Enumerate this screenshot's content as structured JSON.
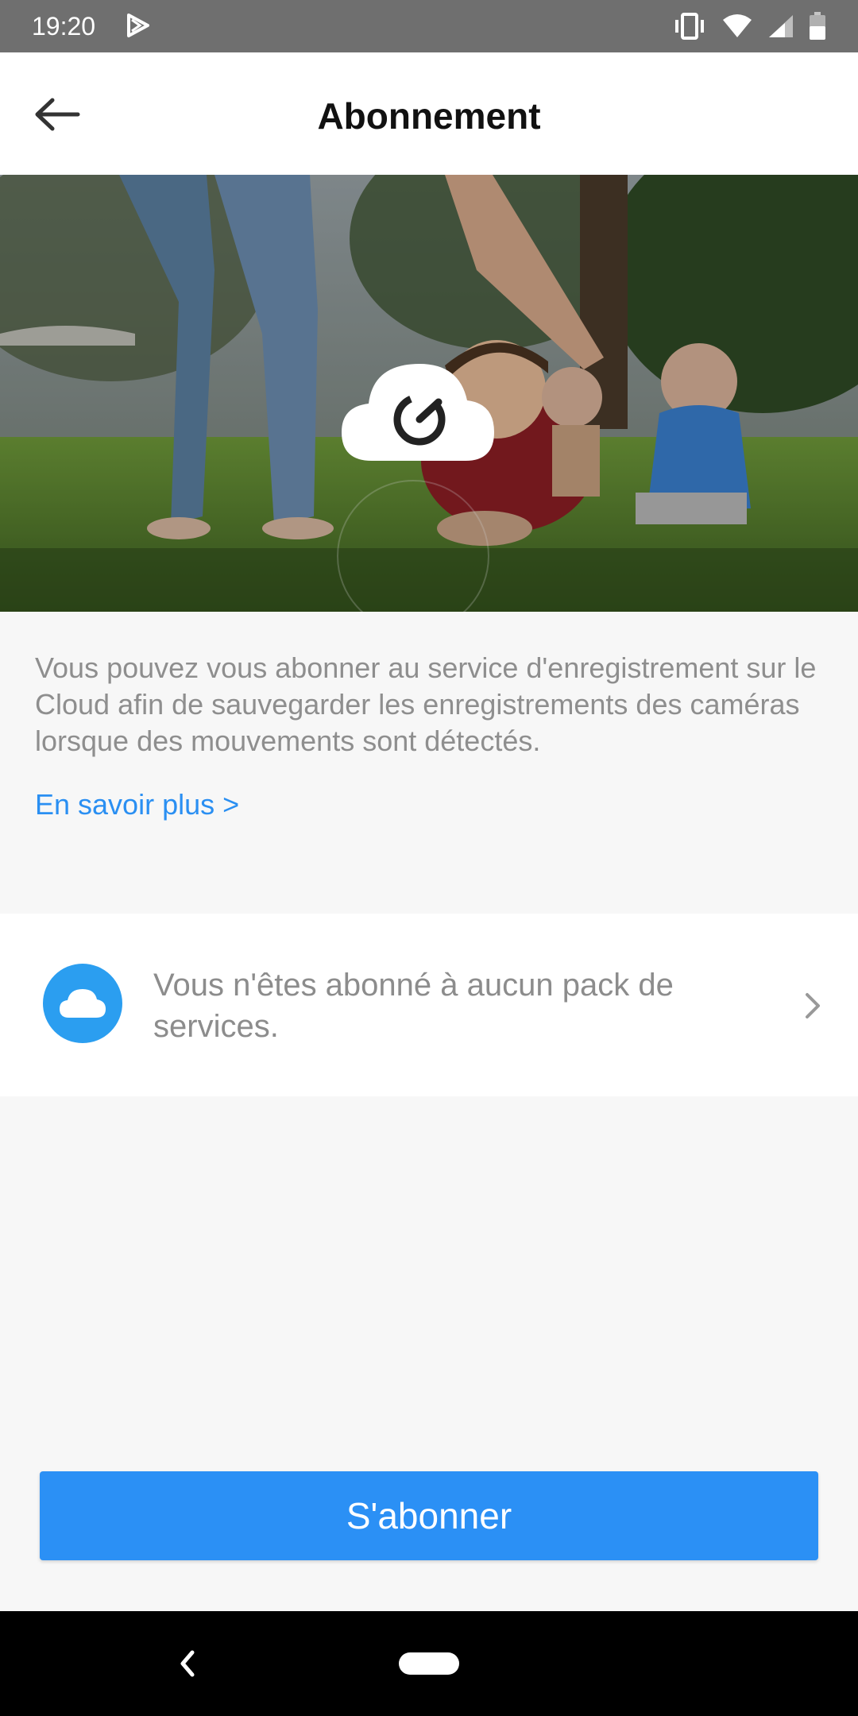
{
  "status_bar": {
    "time": "19:20"
  },
  "app_bar": {
    "title": "Abonnement"
  },
  "hero": {
    "logo_icon": "cloud-logo-icon"
  },
  "description": "Vous pouvez vous abonner au service d'enregistrement sur le Cloud afin de sauvegarder les enregistrements des caméras lorsque des mouvements sont détectés.",
  "learn_more_label": "En savoir plus >",
  "subscription": {
    "icon": "cloud-icon",
    "text": "Vous n'êtes abonné à aucun pack de services."
  },
  "subscribe_button_label": "S'abonner",
  "colors": {
    "accent": "#2b90f5",
    "link": "#2a8ff2",
    "status_bar": "#6f6f6f"
  }
}
